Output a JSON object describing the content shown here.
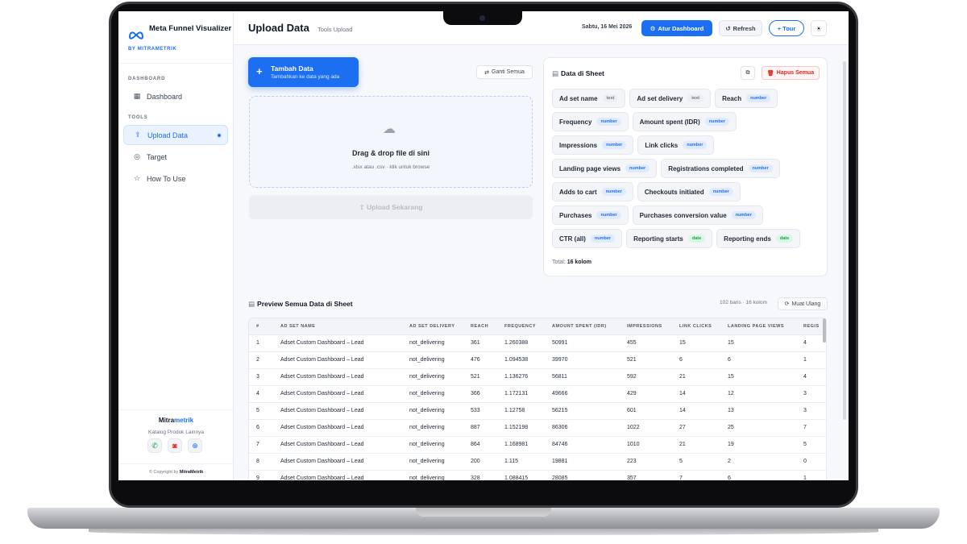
{
  "brand": {
    "title": "Meta Funnel Visualizer",
    "subtitle": "BY MITRAMETRIK"
  },
  "sidebar": {
    "section_dashboard": "DASHBOARD",
    "section_tools": "TOOLS",
    "items": [
      {
        "label": "Dashboard",
        "icon": "grid-icon",
        "active": false
      },
      {
        "label": "Upload Data",
        "icon": "upload-icon",
        "active": true
      },
      {
        "label": "Target",
        "icon": "target-icon",
        "active": false
      },
      {
        "label": "How To Use",
        "icon": "star-icon",
        "active": false
      }
    ],
    "footer": {
      "brand_a": "Mitra",
      "brand_b": "metrik",
      "catalog": "Katalog Produk Lainnya",
      "copyright_prefix": "© Copyright by",
      "copyright_brand": "MitraMetrik"
    }
  },
  "header": {
    "title": "Upload Data",
    "subtitle": "Tools Upload",
    "date": "Sabtu, 16 Mei 2026",
    "atur_button": "Atur Dashboard",
    "refresh_button": "Refresh",
    "tour_button": "+ Tour"
  },
  "upload": {
    "add_title": "Tambah Data",
    "add_sub": "Tambahkan ke data yang ada",
    "replace_button": "Ganti Semua",
    "drop_title": "Drag & drop file di sini",
    "drop_sub": ".xlsx atau .csv · klik untuk browse",
    "upload_button": "⇧ Upload Sekarang"
  },
  "sheet": {
    "title": "Data di Sheet",
    "delete_button": "Hapus Semua",
    "total_prefix": "Total:",
    "total_value": "16 kolom",
    "rows": [
      [
        {
          "name": "Ad set name",
          "type": "text"
        },
        {
          "name": "Ad set delivery",
          "type": "text"
        },
        {
          "name": "Reach",
          "type": "number"
        }
      ],
      [
        {
          "name": "Frequency",
          "type": "number"
        },
        {
          "name": "Amount spent (IDR)",
          "type": "number"
        }
      ],
      [
        {
          "name": "Impressions",
          "type": "number"
        },
        {
          "name": "Link clicks",
          "type": "number"
        }
      ],
      [
        {
          "name": "Landing page views",
          "type": "number"
        },
        {
          "name": "Registrations completed",
          "type": "number"
        }
      ],
      [
        {
          "name": "Adds to cart",
          "type": "number"
        },
        {
          "name": "Checkouts initiated",
          "type": "number"
        }
      ],
      [
        {
          "name": "Purchases",
          "type": "number"
        },
        {
          "name": "Purchases conversion value",
          "type": "number"
        }
      ],
      [
        {
          "name": "CTR (all)",
          "type": "number"
        },
        {
          "name": "Reporting starts",
          "type": "date"
        },
        {
          "name": "Reporting ends",
          "type": "date"
        }
      ]
    ]
  },
  "preview": {
    "title": "Preview Semua Data di Sheet",
    "meta": "102 baris · 16 kolom",
    "reload_button": "Muat Ulang",
    "columns": [
      "#",
      "AD SET NAME",
      "AD SET DELIVERY",
      "REACH",
      "FREQUENCY",
      "AMOUNT SPENT (IDR)",
      "IMPRESSIONS",
      "LINK CLICKS",
      "LANDING PAGE VIEWS",
      "REGIS"
    ],
    "rows": [
      [
        "1",
        "Adset Custom Dashboard – Lead",
        "not_delivering",
        "361",
        "1.260388",
        "50991",
        "455",
        "15",
        "15",
        "4"
      ],
      [
        "2",
        "Adset Custom Dashboard – Lead",
        "not_delivering",
        "476",
        "1.094538",
        "39970",
        "521",
        "6",
        "6",
        "1"
      ],
      [
        "3",
        "Adset Custom Dashboard – Lead",
        "not_delivering",
        "521",
        "1.136276",
        "56811",
        "592",
        "21",
        "15",
        "4"
      ],
      [
        "4",
        "Adset Custom Dashboard – Lead",
        "not_delivering",
        "366",
        "1.172131",
        "49666",
        "429",
        "14",
        "12",
        "3"
      ],
      [
        "5",
        "Adset Custom Dashboard – Lead",
        "not_delivering",
        "533",
        "1.12758",
        "56215",
        "601",
        "14",
        "13",
        "3"
      ],
      [
        "6",
        "Adset Custom Dashboard – Lead",
        "not_delivering",
        "887",
        "1.152198",
        "86306",
        "1022",
        "27",
        "25",
        "7"
      ],
      [
        "7",
        "Adset Custom Dashboard – Lead",
        "not_delivering",
        "864",
        "1.168981",
        "84746",
        "1010",
        "21",
        "19",
        "5"
      ],
      [
        "8",
        "Adset Custom Dashboard – Lead",
        "not_delivering",
        "200",
        "1.115",
        "19881",
        "223",
        "5",
        "2",
        "0"
      ],
      [
        "9",
        "Adset Custom Dashboard – Lead",
        "not_delivering",
        "328",
        "1.088415",
        "28085",
        "357",
        "7",
        "6",
        "1"
      ]
    ]
  },
  "colors": {
    "accent": "#1d6ff2",
    "danger": "#dc2626",
    "date_tag": "#16a34a"
  }
}
